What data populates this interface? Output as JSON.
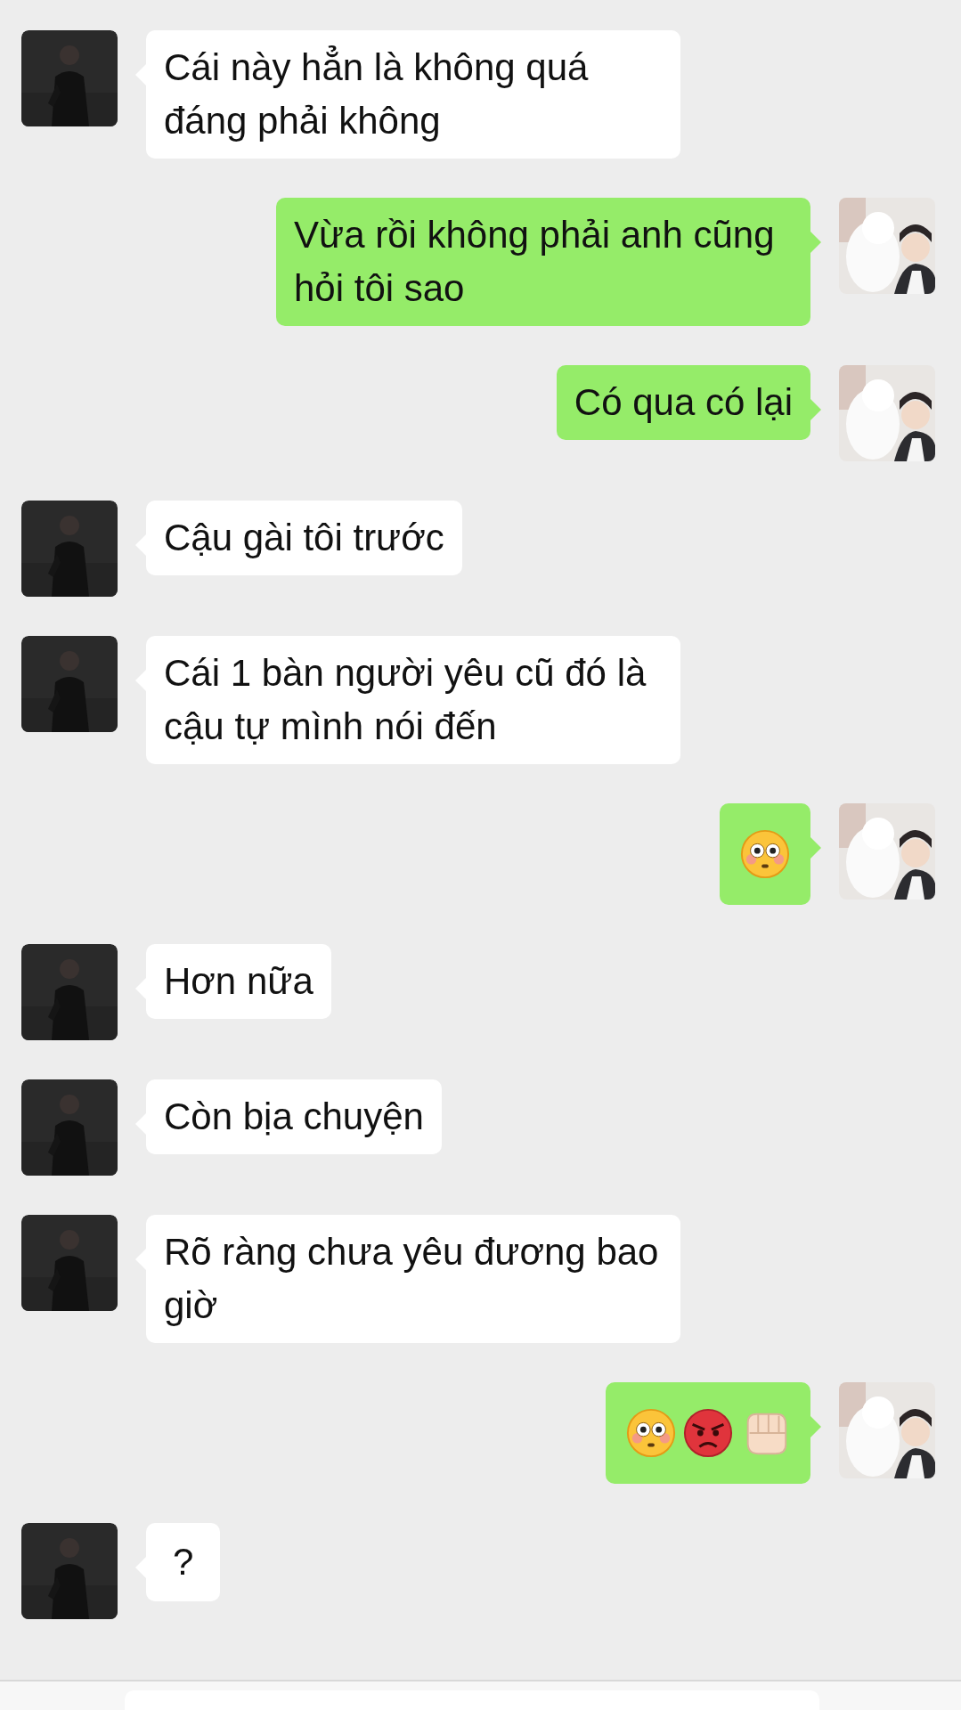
{
  "messages": [
    {
      "mine": false,
      "kind": "text",
      "text": "Cái này hẳn là không quá đáng phải không"
    },
    {
      "mine": true,
      "kind": "text",
      "text": "Vừa rồi không phải anh cũng hỏi tôi sao"
    },
    {
      "mine": true,
      "kind": "text",
      "text": "Có qua có lại"
    },
    {
      "mine": false,
      "kind": "text",
      "text": "Cậu gài tôi trước"
    },
    {
      "mine": false,
      "kind": "text",
      "text": "Cái 1 bàn người yêu cũ đó là cậu tự mình nói đến"
    },
    {
      "mine": true,
      "kind": "emoji",
      "emoji": [
        {
          "kind": "flushed"
        }
      ]
    },
    {
      "mine": false,
      "kind": "text",
      "text": "Hơn nữa"
    },
    {
      "mine": false,
      "kind": "text",
      "text": "Còn bịa chuyện"
    },
    {
      "mine": false,
      "kind": "text",
      "text": "Rõ ràng chưa yêu đương bao giờ"
    },
    {
      "mine": true,
      "kind": "emoji",
      "emoji": [
        {
          "kind": "flushed"
        },
        {
          "kind": "angry"
        },
        {
          "kind": "fist"
        }
      ]
    },
    {
      "mine": false,
      "kind": "text",
      "text": "?"
    }
  ],
  "input_bar": {
    "kind": "field"
  }
}
